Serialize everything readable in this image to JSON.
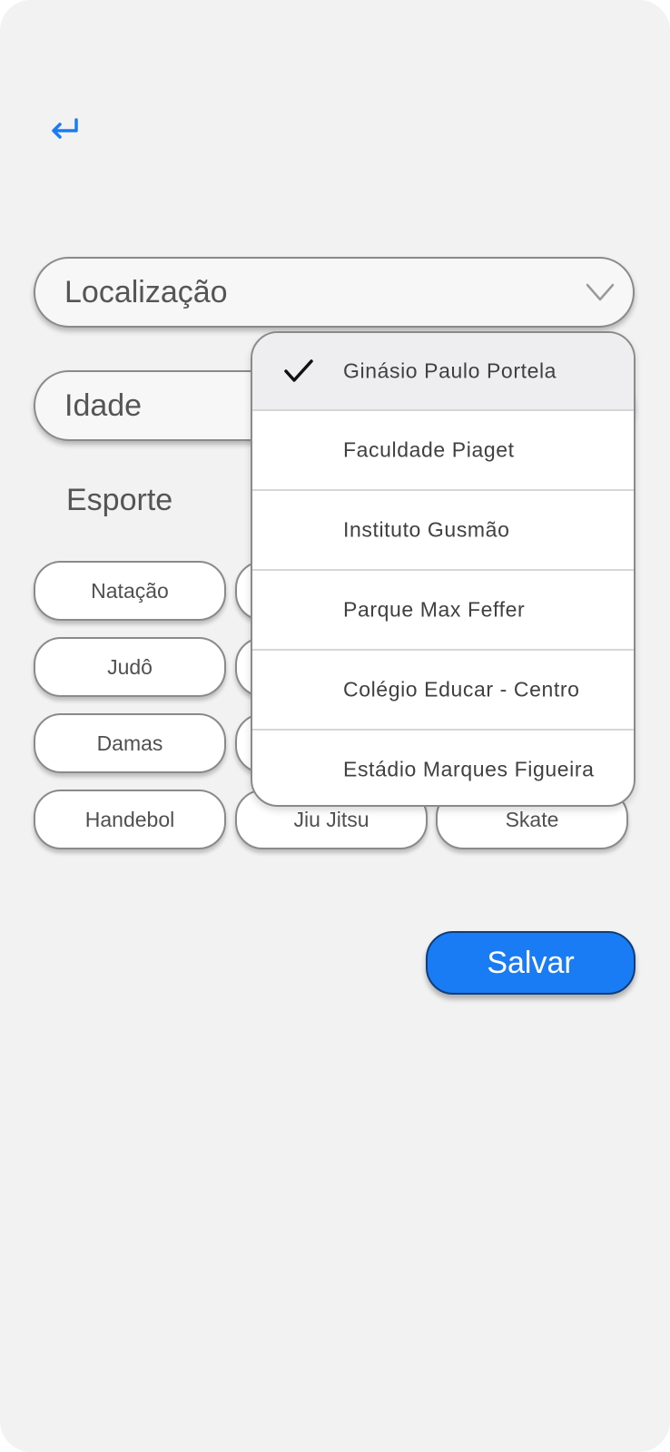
{
  "form": {
    "location_placeholder": "Localização",
    "age_placeholder": "Idade",
    "sport_label": "Esporte",
    "save_label": "Salvar"
  },
  "sports": [
    "Natação",
    "Judô",
    "Damas",
    "Handebol",
    "Jiu Jitsu",
    "Skate"
  ],
  "location_dropdown": {
    "selected": "Ginásio Paulo Portela",
    "options": [
      "Ginásio Paulo Portela",
      "Faculdade Piaget",
      "Instituto Gusmão",
      "Parque Max Feffer",
      "Colégio Educar - Centro",
      "Estádio Marques Figueira"
    ]
  },
  "icons": {
    "back": "return-arrow-icon",
    "dropdown": "chevron-down-icon",
    "selected": "check-icon"
  },
  "colors": {
    "accent": "#1a7cf5",
    "background": "#f2f2f3"
  }
}
